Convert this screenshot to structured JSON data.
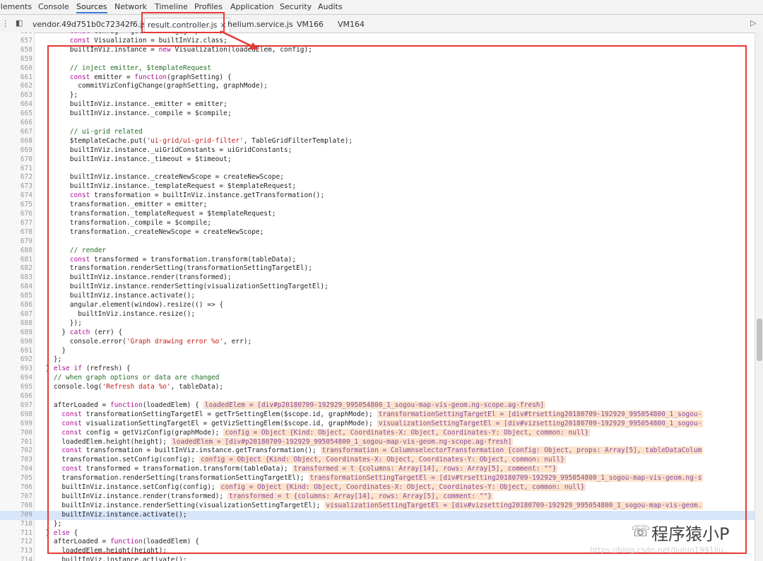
{
  "devtools_tabs": [
    "elements",
    "Console",
    "Sources",
    "Network",
    "Timeline",
    "Profiles",
    "Application",
    "Security",
    "Audits"
  ],
  "active_devtools_tab": "Sources",
  "file_tabs": [
    {
      "label": "vendor.49d751b0c72342f6.js",
      "active": false
    },
    {
      "label": "result.controller.js",
      "active": true,
      "close": "×"
    },
    {
      "label": "helium.service.js",
      "active": false
    },
    {
      "label": "VM166",
      "active": false
    },
    {
      "label": "VM164",
      "active": false
    }
  ],
  "colors": {
    "highlight_box": "#e53935",
    "keyword": "#aa0d91",
    "string": "#c41a16",
    "comment": "#236e25",
    "inline_value_bg": "#fbe3cc",
    "exec_line_bg": "#d8e6fb"
  },
  "code_lines": [
    {
      "n": "656",
      "code": "        const config = getVizConfig(graphMode);"
    },
    {
      "n": "657",
      "code": "        const Visualization = builtInViz.class;"
    },
    {
      "n": "658",
      "code": "        builtInViz.instance = new Visualization(loadedElem, config);"
    },
    {
      "n": "659",
      "code": ""
    },
    {
      "n": "660",
      "code": "        // inject emitter, $templateRequest"
    },
    {
      "n": "661",
      "code": "        const emitter = function(graphSetting) {"
    },
    {
      "n": "662",
      "code": "          commitVizConfigChange(graphSetting, graphMode);"
    },
    {
      "n": "663",
      "code": "        };"
    },
    {
      "n": "664",
      "code": "        builtInViz.instance._emitter = emitter;"
    },
    {
      "n": "665",
      "code": "        builtInViz.instance._compile = $compile;"
    },
    {
      "n": "666",
      "code": ""
    },
    {
      "n": "667",
      "code": "        // ui-grid related"
    },
    {
      "n": "668",
      "code": "        $templateCache.put('ui-grid/ui-grid-filter', TableGridFilterTemplate);"
    },
    {
      "n": "669",
      "code": "        builtInViz.instance._uiGridConstants = uiGridConstants;"
    },
    {
      "n": "670",
      "code": "        builtInViz.instance._timeout = $timeout;"
    },
    {
      "n": "671",
      "code": ""
    },
    {
      "n": "672",
      "code": "        builtInViz.instance._createNewScope = createNewScope;"
    },
    {
      "n": "673",
      "code": "        builtInViz.instance._templateRequest = $templateRequest;"
    },
    {
      "n": "674",
      "code": "        const transformation = builtInViz.instance.getTransformation();"
    },
    {
      "n": "675",
      "code": "        transformation._emitter = emitter;"
    },
    {
      "n": "676",
      "code": "        transformation._templateRequest = $templateRequest;"
    },
    {
      "n": "677",
      "code": "        transformation._compile = $compile;"
    },
    {
      "n": "678",
      "code": "        transformation._createNewScope = createNewScope;"
    },
    {
      "n": "679",
      "code": ""
    },
    {
      "n": "680",
      "code": "        // render"
    },
    {
      "n": "681",
      "code": "        const transformed = transformation.transform(tableData);"
    },
    {
      "n": "682",
      "code": "        transformation.renderSetting(transformationSettingTargetEl);"
    },
    {
      "n": "683",
      "code": "        builtInViz.instance.render(transformed);"
    },
    {
      "n": "684",
      "code": "        builtInViz.instance.renderSetting(visualizationSettingTargetEl);"
    },
    {
      "n": "685",
      "code": "        builtInViz.instance.activate();"
    },
    {
      "n": "686",
      "code": "        angular.element(window).resize(() => {"
    },
    {
      "n": "687",
      "code": "          builtInViz.instance.resize();"
    },
    {
      "n": "688",
      "code": "        });"
    },
    {
      "n": "689",
      "code": "      } catch (err) {"
    },
    {
      "n": "690",
      "code": "        console.error('Graph drawing error %o', err);"
    },
    {
      "n": "691",
      "code": "      }"
    },
    {
      "n": "692",
      "code": "    };"
    },
    {
      "n": "693",
      "code": "  } else if (refresh) {"
    },
    {
      "n": "694",
      "code": "    // when graph options or data are changed"
    },
    {
      "n": "695",
      "code": "    console.log('Refresh data %o', tableData);"
    },
    {
      "n": "696",
      "code": ""
    },
    {
      "n": "697",
      "code": "    afterLoaded = function(loadedElem) {",
      "val": "loadedElem = [div#p20180709-192929_995054800_1_sogou-map-vis-geom.ng-scope.ag-fresh]"
    },
    {
      "n": "698",
      "code": "      const transformationSettingTargetEl = getTrSettingElem($scope.id, graphMode);",
      "val": "transformationSettingTargetEl = [div#trsetting20180709-192929_995054800_1_sogou-"
    },
    {
      "n": "699",
      "code": "      const visualizationSettingTargetEl = getVizSettingElem($scope.id, graphMode);",
      "val": "visualizationSettingTargetEl = [div#vizsetting20180709-192929_995054800_1_sogou-"
    },
    {
      "n": "700",
      "code": "      const config = getVizConfig(graphMode);",
      "val": "config = Object {Kind: Object, Coordinates-X: Object, Coordinates-Y: Object, common: null}"
    },
    {
      "n": "701",
      "code": "      loadedElem.height(height);",
      "val": "loadedElem = [div#p20180709-192929_995054800_1_sogou-map-vis-geom.ng-scope.ag-fresh]"
    },
    {
      "n": "702",
      "code": "      const transformation = builtInViz.instance.getTransformation();",
      "val": "transformation = ColumnselectorTransformation {config: Object, props: Array[5], tableDataColum"
    },
    {
      "n": "703",
      "code": "      transformation.setConfig(config);",
      "val": "config = Object {Kind: Object, Coordinates-X: Object, Coordinates-Y: Object, common: null}"
    },
    {
      "n": "704",
      "code": "      const transformed = transformation.transform(tableData);",
      "val": "transformed = t {columns: Array[14], rows: Array[5], comment: \"\"}"
    },
    {
      "n": "705",
      "code": "      transformation.renderSetting(transformationSettingTargetEl);",
      "val": "transformationSettingTargetEl = [div#trsetting20180709-192929_995054800_1_sogou-map-vis-geom.ng-s"
    },
    {
      "n": "706",
      "code": "      builtInViz.instance.setConfig(config);",
      "val": "config = Object {Kind: Object, Coordinates-X: Object, Coordinates-Y: Object, common: null}"
    },
    {
      "n": "707",
      "code": "      builtInViz.instance.render(transformed);",
      "val": "transformed = t {columns: Array[14], rows: Array[5], comment: \"\"}"
    },
    {
      "n": "708",
      "code": "      builtInViz.instance.renderSetting(visualizationSettingTargetEl);",
      "val": "visualizationSettingTargetEl = [div#vizsetting20180709-192929_995054800_1_sogou-map-vis-geom."
    },
    {
      "n": "709",
      "code": "      builtInViz.instance.activate();",
      "exec": true
    },
    {
      "n": "710",
      "code": "    };"
    },
    {
      "n": "711",
      "code": "  } else {"
    },
    {
      "n": "712",
      "code": "    afterLoaded = function(loadedElem) {"
    },
    {
      "n": "713",
      "code": "      loadedElem.height(height);"
    },
    {
      "n": "714",
      "code": "      builtInViz.instance.activate();"
    }
  ],
  "watermark": {
    "icon": "wechat-icon",
    "text": "程序猿小P"
  },
  "url_watermark": "https://blog.csdn.net/liuhin1991liu..."
}
